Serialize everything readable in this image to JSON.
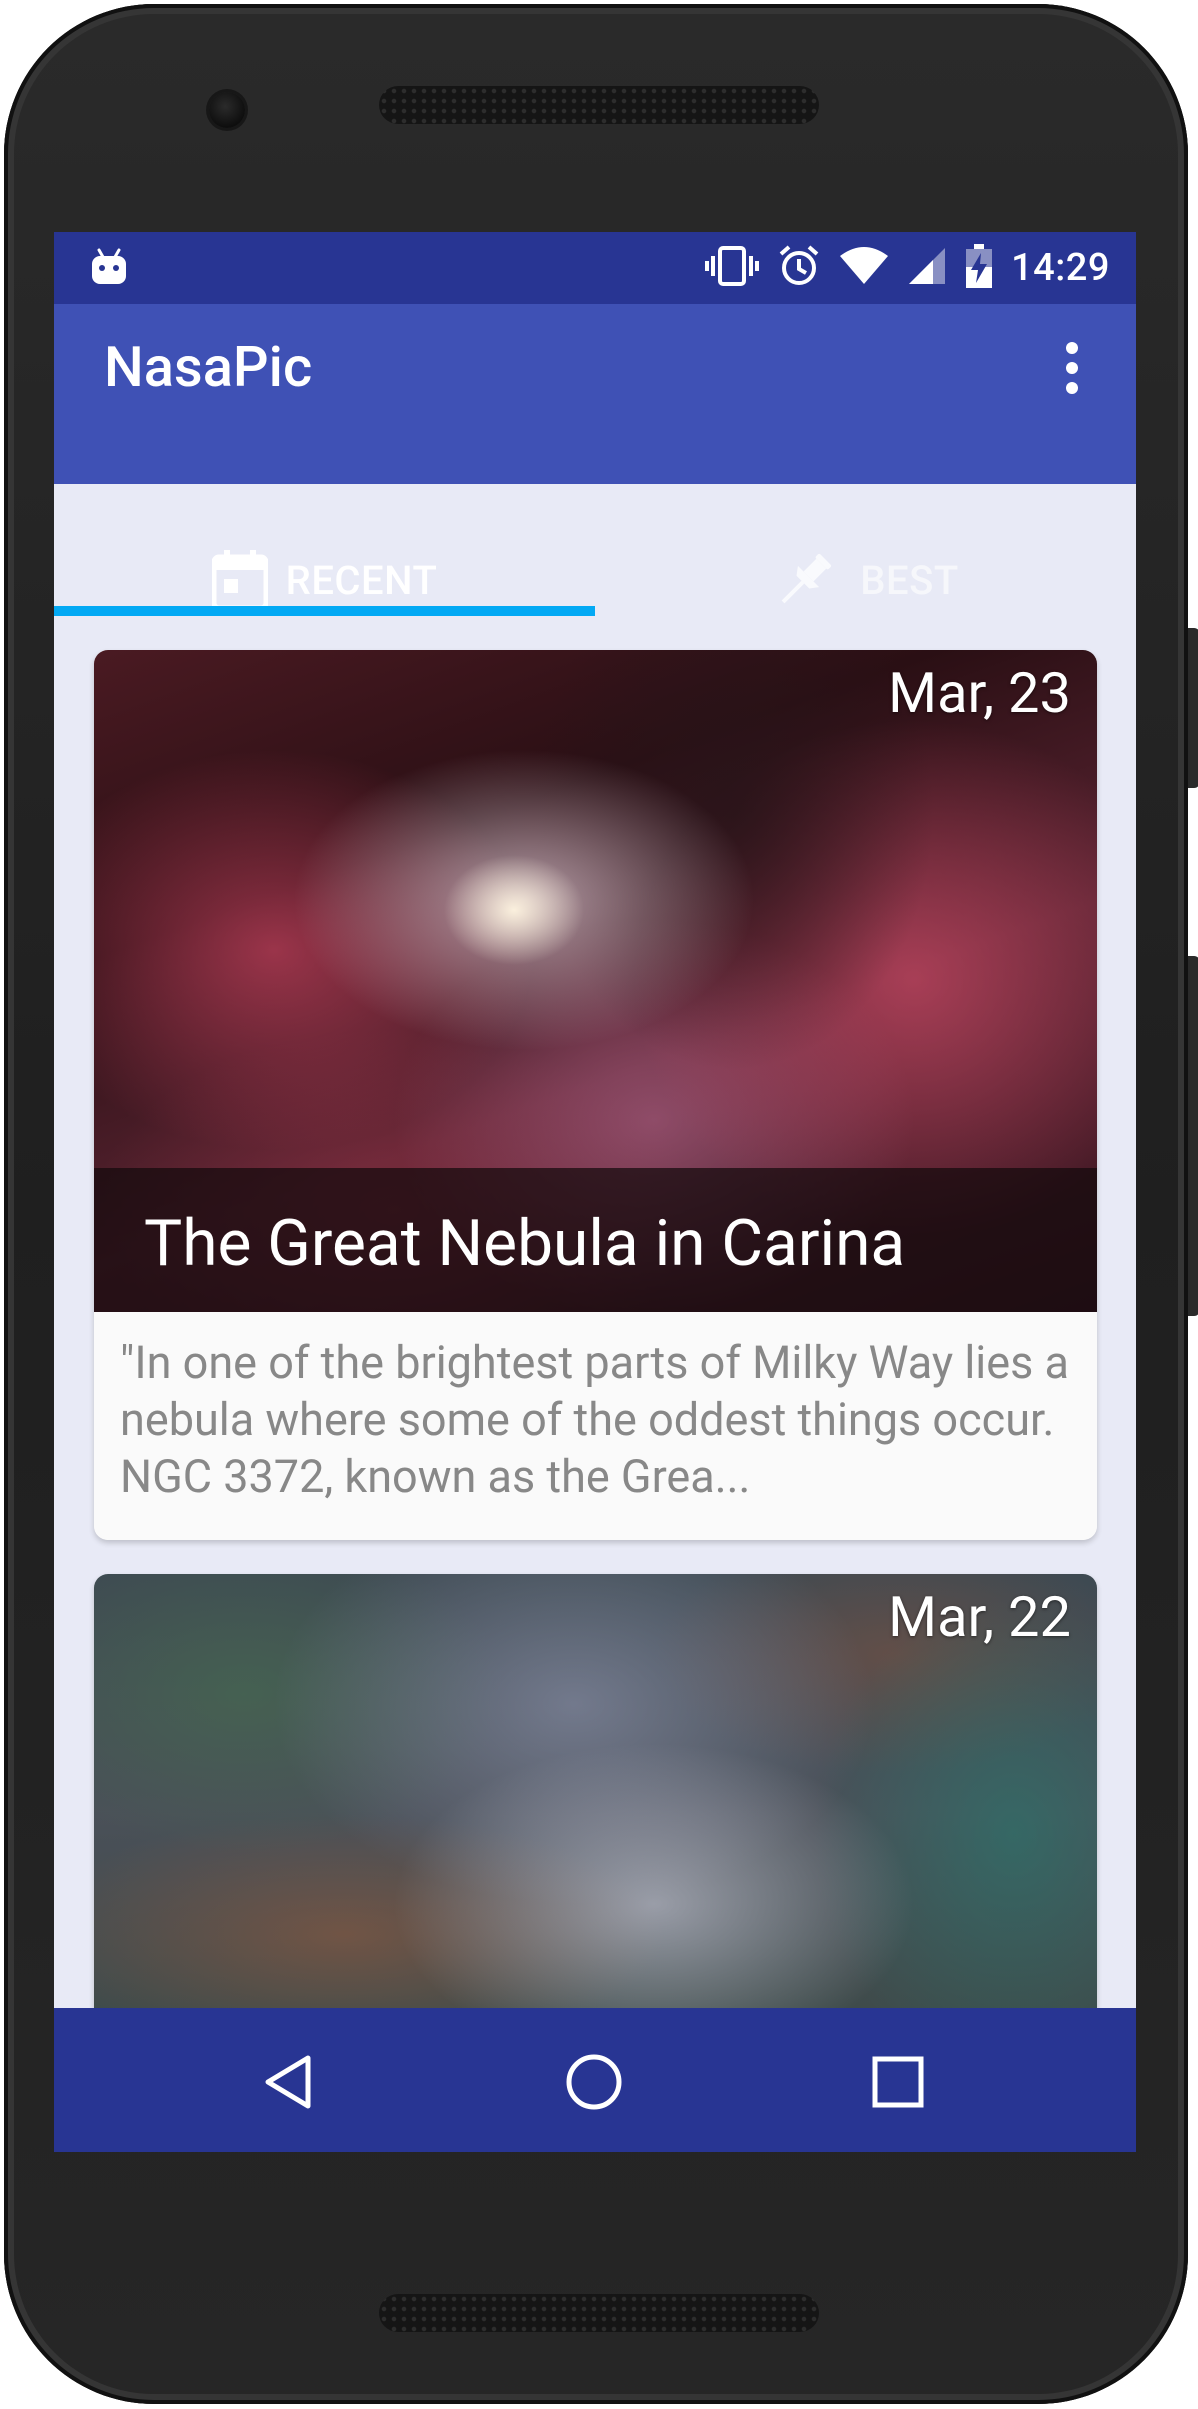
{
  "status_bar": {
    "time": "14:29",
    "icons": [
      "android-debug-icon",
      "vibrate-icon",
      "alarm-icon",
      "wifi-icon",
      "signal-icon",
      "battery-charging-icon"
    ]
  },
  "app_bar": {
    "title": "NasaPic",
    "menu_icon": "overflow-menu-icon"
  },
  "tabs": [
    {
      "label": "RECENT",
      "icon": "calendar-icon",
      "selected": true
    },
    {
      "label": "BEST",
      "icon": "pin-icon",
      "selected": false
    }
  ],
  "cards": [
    {
      "date": "Mar, 23",
      "title": "The Great Nebula in Carina",
      "description": "\"In one of the brightest parts of Milky Way lies a nebula where some of the oddest things occur. NGC 3372, known as the Grea..."
    },
    {
      "date": "Mar, 22"
    }
  ],
  "nav_bar": {
    "icons": [
      "back-icon",
      "home-icon",
      "recents-icon"
    ]
  },
  "colors": {
    "status_bar": "#283593",
    "primary": "#3f51b5",
    "tab_indicator": "#03a9f4",
    "background": "#e8eaf6"
  }
}
